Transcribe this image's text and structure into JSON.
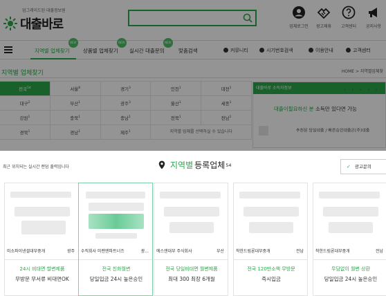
{
  "header": {
    "logo_subtitle": "업그레이드된 대출정보원",
    "logo_title": "대출바로",
    "search_placeholder": "",
    "top_icons": [
      {
        "icon": "user-icon",
        "label": "업체로그인"
      },
      {
        "icon": "handshake-icon",
        "label": "광고제휴"
      },
      {
        "icon": "help-icon",
        "label": "고객센터"
      },
      {
        "icon": "megaphone-icon",
        "label": "공지사항"
      }
    ]
  },
  "nav": {
    "items": [
      "지역별 업체찾기",
      "상품별 업체찾기",
      "실시간 대출문의",
      "맞춤검색"
    ],
    "new_badge": "NEW",
    "right_items": [
      "커뮤니티",
      "시기번호검색",
      "이용안내",
      "고객센터"
    ]
  },
  "section": {
    "title": "지역별 업체찾기",
    "breadcrumb": "HOME  >  지역별업체찾"
  },
  "regions": [
    {
      "name": "전국",
      "count": "54",
      "active": true
    },
    {
      "name": "서울",
      "count": "8"
    },
    {
      "name": "경기",
      "count": "3"
    },
    {
      "name": "인천",
      "count": "1"
    },
    {
      "name": "대전",
      "count": "1"
    },
    {
      "name": "대구",
      "count": "2"
    },
    {
      "name": "부산",
      "count": "1"
    },
    {
      "name": "광주",
      "count": "3"
    },
    {
      "name": "울산",
      "count": "1"
    },
    {
      "name": "세종",
      "count": "1"
    },
    {
      "name": "강원",
      "count": "1"
    },
    {
      "name": "충북",
      "count": "1"
    },
    {
      "name": "충남",
      "count": "1"
    },
    {
      "name": "전북",
      "count": "1"
    },
    {
      "name": "전남",
      "count": "1"
    },
    {
      "name": "경북",
      "count": "1"
    },
    {
      "name": "경남",
      "count": "1"
    },
    {
      "name": "제주",
      "count": "1"
    }
  ],
  "region_note": "지역별 업체를 선택하실 수 있습니다",
  "side_box": {
    "header": "대출바로 소득자정보",
    "headline_green": "대출이필요하신 분",
    "headline_rest": "소득만 있다면 가능",
    "row_text": "추천된 당일대출 / 빠른승인대출은(주)대출"
  },
  "modal": {
    "notice": "최근 위치되는 실시간 랜덤 출력입니다",
    "title_green": "지역별",
    "title_rest": "등록업체",
    "title_count": "54",
    "ad_button": "광고문의",
    "cards": [
      {
        "name": "미소파이낸셜대부중개",
        "region": "광주",
        "line1": "24시 비대면 할변제품",
        "line2": "무방문 무서류 비대면OK",
        "selected": false
      },
      {
        "name": "수직회사 미랜엔파트너즈",
        "region": "광...",
        "line1": "전국 친화월변",
        "line2": "당일입금 24시 높은승인",
        "selected": true
      },
      {
        "name": "에스앤대부 주식회사",
        "region": "부산",
        "line1": "전국 당일비대면 월변제품",
        "line2": "최대 300 최장 6개월",
        "selected": false
      },
      {
        "name": "착한드림론대부중개",
        "region": "전남",
        "line1": "전국 120만소액 무방문",
        "line2": "즉시입금",
        "selected": false
      },
      {
        "name": "착한드림론대부중개",
        "region": "전남",
        "line1": "무담없이 월변 상환",
        "line2": "당일입금 24시 높은승인",
        "selected": false
      }
    ]
  },
  "colors": {
    "accent": "#2ba84a",
    "selected_border": "#7bd2a6",
    "overlay": "rgba(0,0,0,0.42)"
  }
}
